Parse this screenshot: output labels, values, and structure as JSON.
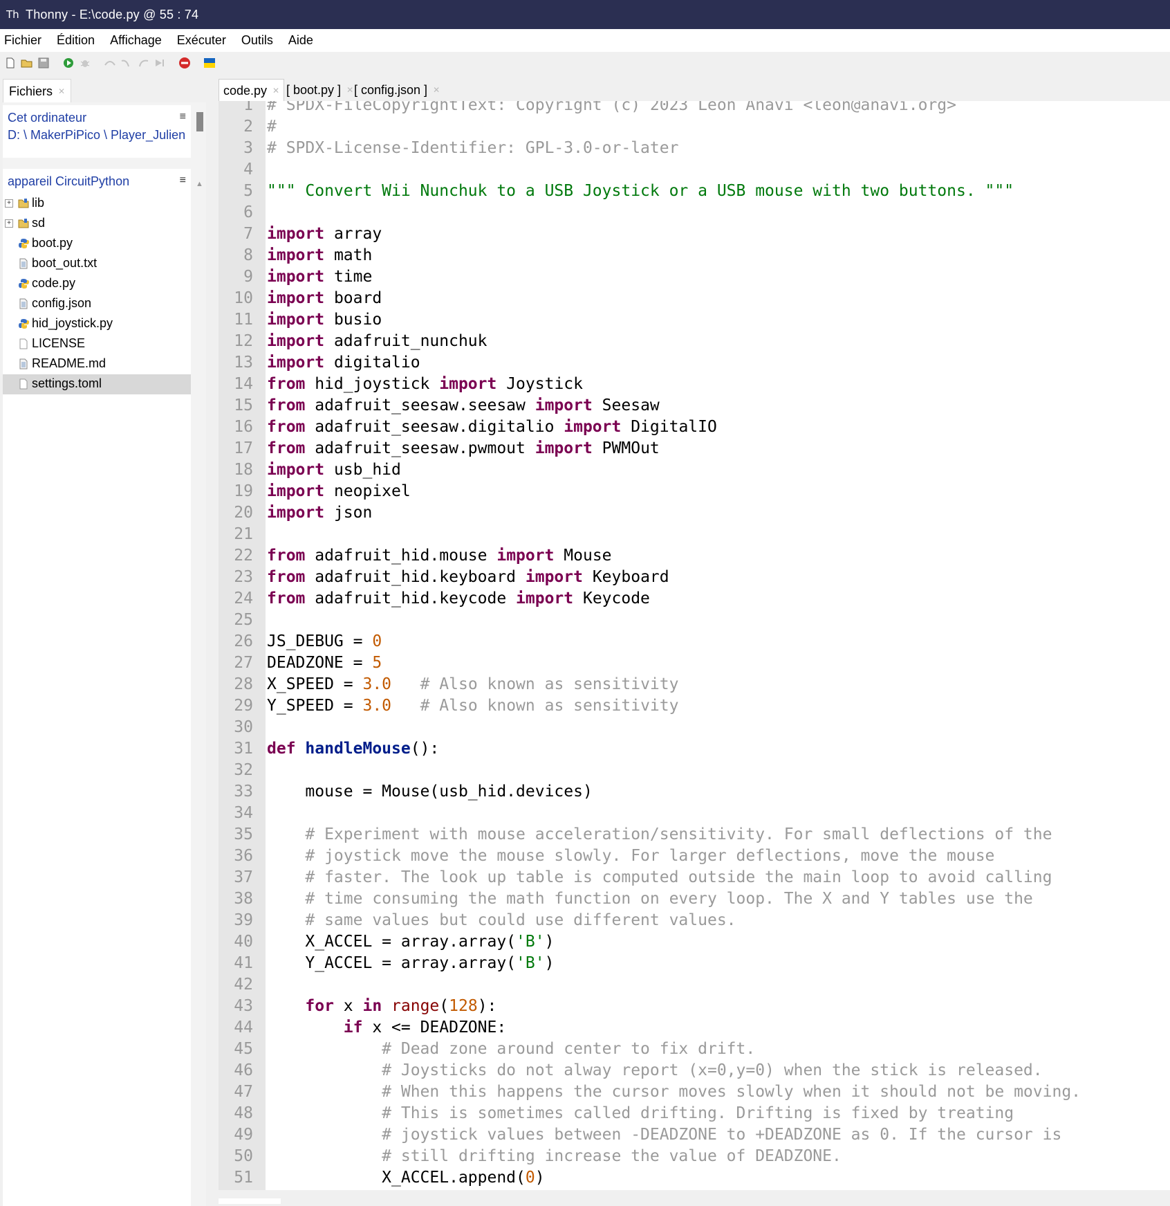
{
  "window": {
    "title": "Thonny  -  E:\\code.py  @  55 : 74",
    "app_icon": "thonny-icon"
  },
  "menubar": {
    "items": [
      "Fichier",
      "Édition",
      "Affichage",
      "Exécuter",
      "Outils",
      "Aide"
    ]
  },
  "toolbar": {
    "icons": [
      "new-file-icon",
      "open-file-icon",
      "save-icon",
      "run-icon",
      "debug-icon",
      "step-over-icon",
      "step-into-icon",
      "step-out-icon",
      "resume-icon",
      "stop-icon",
      "ukraine-flag-icon"
    ]
  },
  "files_panel": {
    "tab_label": "Fichiers",
    "computer": {
      "title": "Cet ordinateur",
      "path": "D: \\ MakerPiPico \\ Player_Julien"
    },
    "device": {
      "title": "appareil CircuitPython",
      "items": [
        {
          "label": "lib",
          "kind": "folder"
        },
        {
          "label": "sd",
          "kind": "folder"
        },
        {
          "label": "boot.py",
          "kind": "python"
        },
        {
          "label": "boot_out.txt",
          "kind": "text"
        },
        {
          "label": "code.py",
          "kind": "python"
        },
        {
          "label": "config.json",
          "kind": "text"
        },
        {
          "label": "hid_joystick.py",
          "kind": "python"
        },
        {
          "label": "LICENSE",
          "kind": "blank"
        },
        {
          "label": "README.md",
          "kind": "text"
        },
        {
          "label": "settings.toml",
          "kind": "blank",
          "selected": true
        }
      ]
    }
  },
  "editor": {
    "tabs": [
      {
        "label": "code.py",
        "active": true
      },
      {
        "label": "[ boot.py ]",
        "active": false
      },
      {
        "label": "[ config.json ]",
        "active": false
      }
    ],
    "lines": [
      [
        [
          "c",
          "# SPDX-FileCopyrightText: Copyright (c) 2023 Leon Anavi <leon@anavi.org>"
        ]
      ],
      [
        [
          "c",
          "#"
        ]
      ],
      [
        [
          "c",
          "# SPDX-License-Identifier: GPL-3.0-or-later"
        ]
      ],
      [],
      [
        [
          "s",
          "\"\"\" Convert Wii Nunchuk to a USB Joystick or a USB mouse with two buttons. \"\"\""
        ]
      ],
      [],
      [
        [
          "k",
          "import"
        ],
        [
          "t",
          " array"
        ]
      ],
      [
        [
          "k",
          "import"
        ],
        [
          "t",
          " math"
        ]
      ],
      [
        [
          "k",
          "import"
        ],
        [
          "t",
          " time"
        ]
      ],
      [
        [
          "k",
          "import"
        ],
        [
          "t",
          " board"
        ]
      ],
      [
        [
          "k",
          "import"
        ],
        [
          "t",
          " busio"
        ]
      ],
      [
        [
          "k",
          "import"
        ],
        [
          "t",
          " adafruit_nunchuk"
        ]
      ],
      [
        [
          "k",
          "import"
        ],
        [
          "t",
          " digitalio"
        ]
      ],
      [
        [
          "k",
          "from"
        ],
        [
          "t",
          " hid_joystick "
        ],
        [
          "k",
          "import"
        ],
        [
          "t",
          " Joystick"
        ]
      ],
      [
        [
          "k",
          "from"
        ],
        [
          "t",
          " adafruit_seesaw.seesaw "
        ],
        [
          "k",
          "import"
        ],
        [
          "t",
          " Seesaw"
        ]
      ],
      [
        [
          "k",
          "from"
        ],
        [
          "t",
          " adafruit_seesaw.digitalio "
        ],
        [
          "k",
          "import"
        ],
        [
          "t",
          " DigitalIO"
        ]
      ],
      [
        [
          "k",
          "from"
        ],
        [
          "t",
          " adafruit_seesaw.pwmout "
        ],
        [
          "k",
          "import"
        ],
        [
          "t",
          " PWMOut"
        ]
      ],
      [
        [
          "k",
          "import"
        ],
        [
          "t",
          " usb_hid"
        ]
      ],
      [
        [
          "k",
          "import"
        ],
        [
          "t",
          " neopixel"
        ]
      ],
      [
        [
          "k",
          "import"
        ],
        [
          "t",
          " json"
        ]
      ],
      [],
      [
        [
          "k",
          "from"
        ],
        [
          "t",
          " adafruit_hid.mouse "
        ],
        [
          "k",
          "import"
        ],
        [
          "t",
          " Mouse"
        ]
      ],
      [
        [
          "k",
          "from"
        ],
        [
          "t",
          " adafruit_hid.keyboard "
        ],
        [
          "k",
          "import"
        ],
        [
          "t",
          " Keyboard"
        ]
      ],
      [
        [
          "k",
          "from"
        ],
        [
          "t",
          " adafruit_hid.keycode "
        ],
        [
          "k",
          "import"
        ],
        [
          "t",
          " Keycode"
        ]
      ],
      [],
      [
        [
          "t",
          "JS_DEBUG = "
        ],
        [
          "n",
          "0"
        ]
      ],
      [
        [
          "t",
          "DEADZONE = "
        ],
        [
          "n",
          "5"
        ]
      ],
      [
        [
          "t",
          "X_SPEED = "
        ],
        [
          "n",
          "3.0"
        ],
        [
          "t",
          "   "
        ],
        [
          "c",
          "# Also known as sensitivity"
        ]
      ],
      [
        [
          "t",
          "Y_SPEED = "
        ],
        [
          "n",
          "3.0"
        ],
        [
          "t",
          "   "
        ],
        [
          "c",
          "# Also known as sensitivity"
        ]
      ],
      [],
      [
        [
          "k",
          "def"
        ],
        [
          "t",
          " "
        ],
        [
          "f",
          "handleMouse"
        ],
        [
          "t",
          "():"
        ]
      ],
      [],
      [
        [
          "t",
          "    mouse = Mouse(usb_hid.devices)"
        ]
      ],
      [],
      [
        [
          "t",
          "    "
        ],
        [
          "c",
          "# Experiment with mouse acceleration/sensitivity. For small deflections of the"
        ]
      ],
      [
        [
          "t",
          "    "
        ],
        [
          "c",
          "# joystick move the mouse slowly. For larger deflections, move the mouse"
        ]
      ],
      [
        [
          "t",
          "    "
        ],
        [
          "c",
          "# faster. The look up table is computed outside the main loop to avoid calling"
        ]
      ],
      [
        [
          "t",
          "    "
        ],
        [
          "c",
          "# time consuming the math function on every loop. The X and Y tables use the"
        ]
      ],
      [
        [
          "t",
          "    "
        ],
        [
          "c",
          "# same values but could use different values."
        ]
      ],
      [
        [
          "t",
          "    X_ACCEL = array.array("
        ],
        [
          "s",
          "'B'"
        ],
        [
          "t",
          ")"
        ]
      ],
      [
        [
          "t",
          "    Y_ACCEL = array.array("
        ],
        [
          "s",
          "'B'"
        ],
        [
          "t",
          ")"
        ]
      ],
      [],
      [
        [
          "t",
          "    "
        ],
        [
          "k",
          "for"
        ],
        [
          "t",
          " x "
        ],
        [
          "k",
          "in"
        ],
        [
          "t",
          " "
        ],
        [
          "b",
          "range"
        ],
        [
          "t",
          "("
        ],
        [
          "n",
          "128"
        ],
        [
          "t",
          "):"
        ]
      ],
      [
        [
          "t",
          "        "
        ],
        [
          "k",
          "if"
        ],
        [
          "t",
          " x <= DEADZONE:"
        ]
      ],
      [
        [
          "t",
          "            "
        ],
        [
          "c",
          "# Dead zone around center to fix drift."
        ]
      ],
      [
        [
          "t",
          "            "
        ],
        [
          "c",
          "# Joysticks do not alway report (x=0,y=0) when the stick is released."
        ]
      ],
      [
        [
          "t",
          "            "
        ],
        [
          "c",
          "# When this happens the cursor moves slowly when it should not be moving."
        ]
      ],
      [
        [
          "t",
          "            "
        ],
        [
          "c",
          "# This is sometimes called drifting. Drifting is fixed by treating"
        ]
      ],
      [
        [
          "t",
          "            "
        ],
        [
          "c",
          "# joystick values between -DEADZONE to +DEADZONE as 0. If the cursor is"
        ]
      ],
      [
        [
          "t",
          "            "
        ],
        [
          "c",
          "# still drifting increase the value of DEADZONE."
        ]
      ],
      [
        [
          "t",
          "            X_ACCEL.append("
        ],
        [
          "n",
          "0"
        ],
        [
          "t",
          ")"
        ]
      ]
    ]
  }
}
